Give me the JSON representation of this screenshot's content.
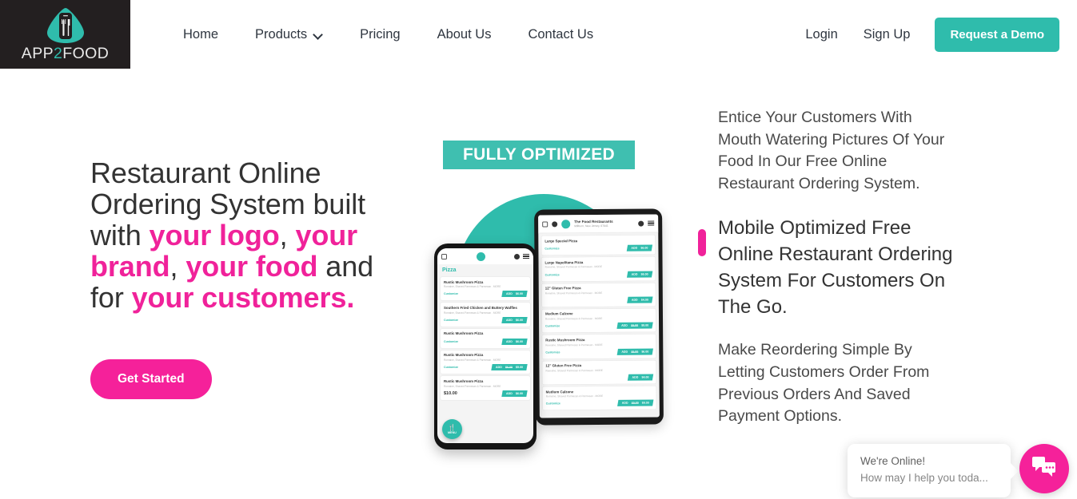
{
  "brand": {
    "logo_word_part1": "APP",
    "logo_word_two": "2",
    "logo_word_part2": "FOOD",
    "logo_icon": "phone-fork-knife-logo",
    "teal": "#2FBCAC",
    "pink": "#F5219A",
    "dark": "#231F20"
  },
  "header": {
    "nav": [
      {
        "label": "Home",
        "has_caret": false
      },
      {
        "label": "Products",
        "has_caret": true
      },
      {
        "label": "Pricing",
        "has_caret": false
      },
      {
        "label": "About Us",
        "has_caret": false
      },
      {
        "label": "Contact Us",
        "has_caret": false
      }
    ],
    "login_label": "Login",
    "signup_label": "Sign Up",
    "demo_label": "Request a Demo"
  },
  "hero": {
    "title_part1": "Restaurant Online Ordering System built with ",
    "title_hl1": "your logo",
    "title_comma1": ", ",
    "title_hl2": "your brand",
    "title_comma2": ", ",
    "title_hl3": "your food",
    "title_mid": " and for ",
    "title_hl4": "your customers.",
    "cta_label": "Get Started"
  },
  "art": {
    "badge_label": "FULLY OPTIMIZED",
    "tablet": {
      "restaurant_name": "The Food Restaurants",
      "restaurant_address": "Millburn, New Jersey, 07041",
      "items": [
        {
          "name": "Large Special Pizza",
          "desc": "",
          "customize": "Customize",
          "add": "ADD",
          "price": "$6.00",
          "old_price": ""
        },
        {
          "name": "Large Napolitana Pizza",
          "desc": "Romaine, Shaved Parmesan & Parmesan . MORE",
          "customize": "Customize",
          "add": "ADD",
          "price": "$6.00",
          "old_price": ""
        },
        {
          "name": "12\" Gluten Free Pizza",
          "desc": "Romaine, Shaved Parmesan & Parmesan . MORE",
          "customize": "",
          "add": "ADD",
          "price": "$4.00",
          "old_price": ""
        },
        {
          "name": "Medium Calzone",
          "desc": "Romaine, Shaved Parmesan & Parmesan . MORE",
          "customize": "Customize",
          "add": "ADD",
          "price": "$9.00",
          "old_price": "$9.00"
        },
        {
          "name": "Rustic Mushroom Pizza",
          "desc": "Romaine, Shaved Parmesan & Parmesan . MORE",
          "customize": "Customize",
          "add": "ADD",
          "price": "$6.00",
          "old_price": "$9.00"
        },
        {
          "name": "12\" Gluten Free Pizza",
          "desc": "Romaine, Shaved Parmesan & Parmesan . MORE",
          "customize": "",
          "add": "ADD",
          "price": "$4.00",
          "old_price": ""
        },
        {
          "name": "Medium Calzone",
          "desc": "Romaine, Shaved Parmesan & Parmesan . MORE",
          "customize": "Customize",
          "add": "ADD",
          "price": "$9.00",
          "old_price": "$9.00"
        }
      ]
    },
    "phone": {
      "section_title": "Pizza",
      "menu_fab_label": "MENU",
      "cart_total": "$10.00",
      "items": [
        {
          "name": "Rustic Mushroom Pizza",
          "desc": "Romaine, Shaved Parmesan & Parmesan . MORE",
          "customize": "Customize",
          "add": "ADD",
          "price": "$6.00",
          "old_price": ""
        },
        {
          "name": "Southern Fried Chicken and Buttery Waffles",
          "desc": "Romaine, Shaved Parmesan & Parmesan . MORE",
          "customize": "Customize",
          "add": "ADD",
          "price": "$6.00",
          "old_price": ""
        },
        {
          "name": "Rustic Mushroom Pizza",
          "desc": "",
          "customize": "Customize",
          "add": "ADD",
          "price": "$6.00",
          "old_price": ""
        },
        {
          "name": "Rustic Mushroom Pizza",
          "desc": "Romaine, Shaved Parmesan & Parmesan . MORE",
          "customize": "Customize",
          "add": "ADD",
          "price": "$5.00",
          "old_price": "$6.00"
        },
        {
          "name": "Rustic Mushroom Pizza",
          "desc": "Romaine, Shaved Parmesan & Parmesan . MORE",
          "customize": "",
          "add": "ADD",
          "price": "$6.00",
          "old_price": ""
        }
      ]
    }
  },
  "features": [
    {
      "text": "Entice Your Customers With Mouth Watering Pictures Of Your Food In Our Free Online Restaurant Ordering System.",
      "active": false
    },
    {
      "text": "Mobile Optimized Free Online Restaurant Ordering System For Customers On The Go.",
      "active": true
    },
    {
      "text": "Make Reordering Simple By Letting Customers Order From Previous Orders And Saved Payment Options.",
      "active": false
    }
  ],
  "chat": {
    "line1": "We're Online!",
    "line2": "How may I help you toda...",
    "icon": "chat-bubbles-icon"
  }
}
